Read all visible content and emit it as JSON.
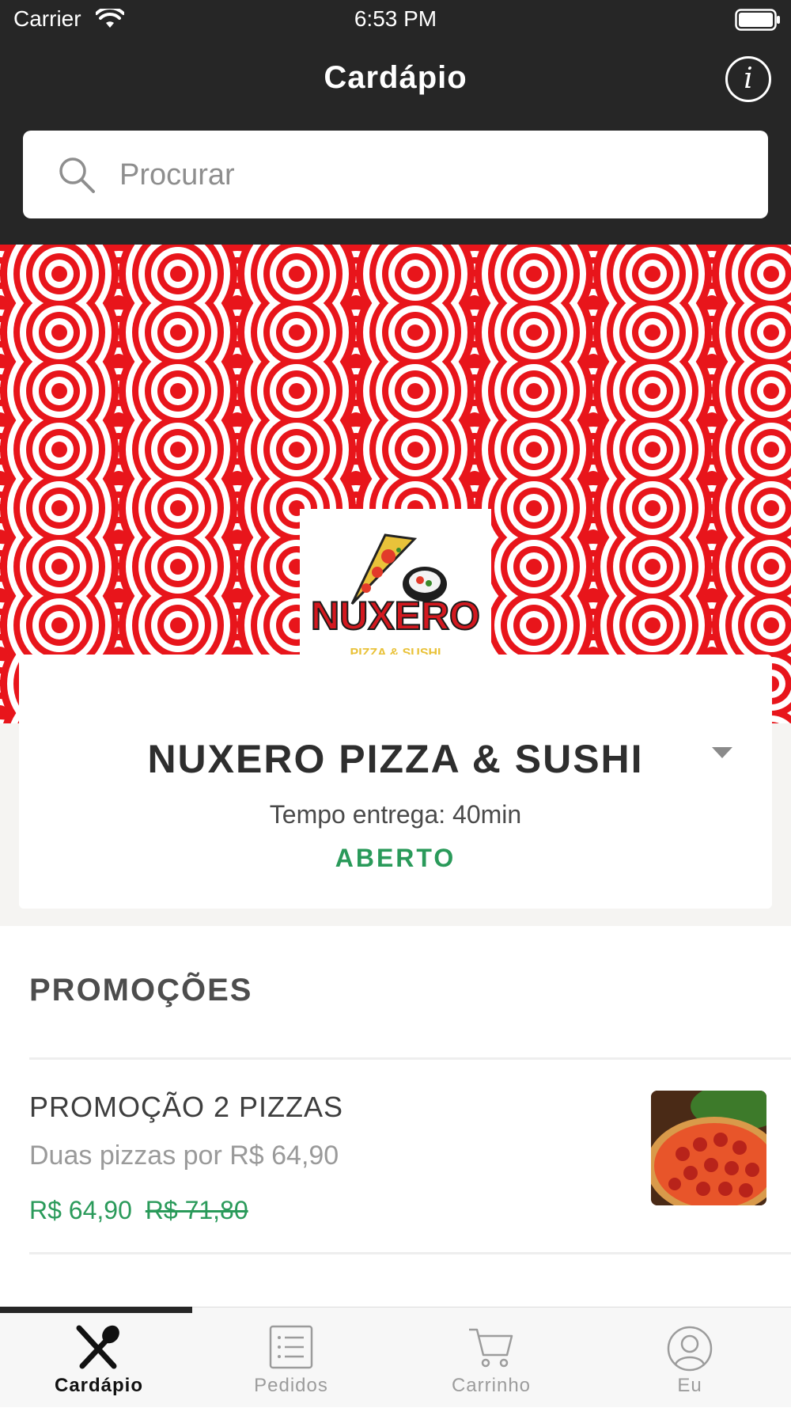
{
  "status_bar": {
    "carrier": "Carrier",
    "time": "6:53 PM"
  },
  "header": {
    "title": "Cardápio",
    "info_icon": "info-icon"
  },
  "search": {
    "placeholder": "Procurar"
  },
  "restaurant": {
    "name": "NUXERO PIZZA & SUSHI",
    "logo_text": "NUXERO",
    "logo_subtext": "PIZZA & SUSHI",
    "delivery_time": "Tempo entrega: 40min",
    "status": "ABERTO"
  },
  "promotions": {
    "section_title": "PROMOÇÕES",
    "items": [
      {
        "name": "PROMOÇÃO 2 PIZZAS",
        "description": "Duas pizzas por R$ 64,90",
        "price": "R$ 64,90",
        "old_price": "R$ 71,80"
      }
    ]
  },
  "tabs": [
    {
      "label": "Cardápio",
      "icon": "cutlery-icon",
      "active": true
    },
    {
      "label": "Pedidos",
      "icon": "list-icon",
      "active": false
    },
    {
      "label": "Carrinho",
      "icon": "cart-icon",
      "active": false
    },
    {
      "label": "Eu",
      "icon": "user-icon",
      "active": false
    }
  ],
  "colors": {
    "header_bg": "#262626",
    "banner_red": "#e8151b",
    "open_green": "#2a9a5a"
  }
}
